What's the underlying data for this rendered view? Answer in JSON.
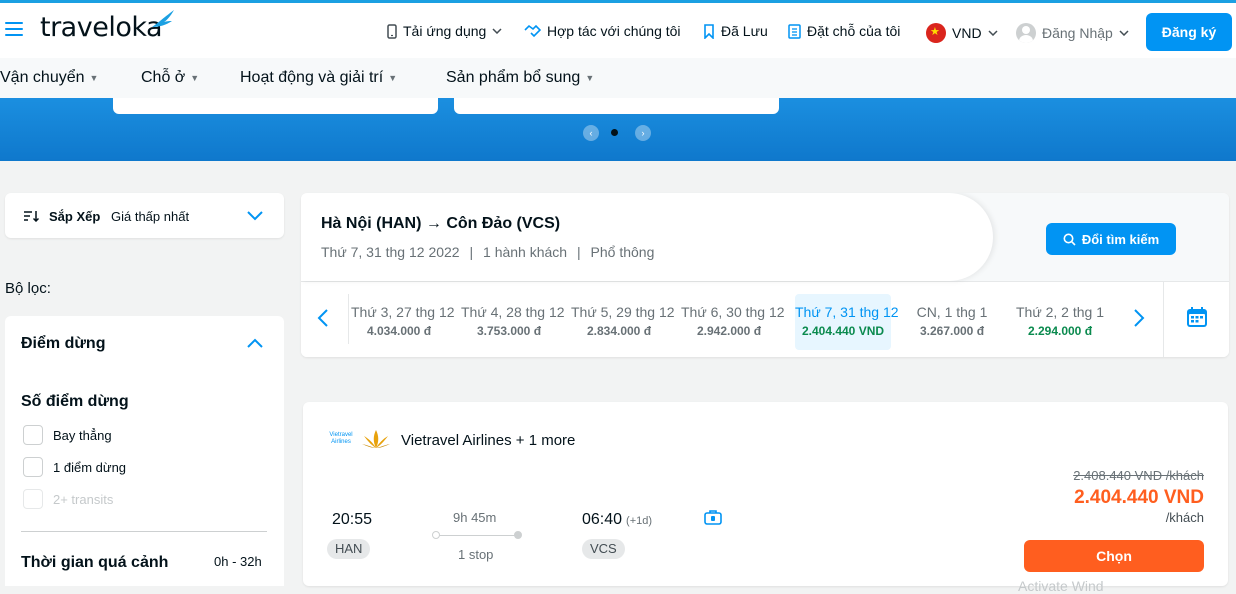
{
  "header": {
    "logo_text": "traveloka",
    "nav": {
      "app": "Tải ứng dụng",
      "partner": "Hợp tác với chúng tôi",
      "saved": "Đã Lưu",
      "bookings": "Đặt chỗ của tôi",
      "currency": "VND",
      "login": "Đăng Nhập",
      "register": "Đăng ký"
    },
    "colors": {
      "brand_blue": "#0194f3",
      "accent_orange": "#ff5e1f"
    }
  },
  "subnav": {
    "items": [
      "Vận chuyển",
      "Chỗ ở",
      "Hoạt động và giải trí",
      "Sản phẩm bổ sung"
    ]
  },
  "sort": {
    "label": "Sắp Xếp",
    "value": "Giá thấp nhất"
  },
  "filters": {
    "title": "Bộ lọc:",
    "section_stops": "Điểm dừng",
    "stops_heading": "Số điểm dừng",
    "stop_options": [
      "Bay thẳng",
      "1 điểm dừng",
      "2+ transits"
    ],
    "transit_label": "Thời gian quá cảnh",
    "transit_range": "0h - 32h"
  },
  "route": {
    "title": "Hà Nội (HAN) → Côn Đảo (VCS)",
    "date": "Thứ 7, 31 thg 12 2022",
    "passengers": "1 hành khách",
    "cabin": "Phổ thông",
    "separator": "|",
    "change_button": "Đổi tìm kiếm"
  },
  "dates": [
    {
      "day": "Thứ 3, 27 thg 12",
      "price": "4.034.000 đ"
    },
    {
      "day": "Thứ 4, 28 thg 12",
      "price": "3.753.000 đ"
    },
    {
      "day": "Thứ 5, 29 thg 12",
      "price": "2.834.000 đ"
    },
    {
      "day": "Thứ 6, 30 thg 12",
      "price": "2.942.000 đ"
    },
    {
      "day": "Thứ 7, 31 thg 12",
      "price": "2.404.440 VND"
    },
    {
      "day": "CN, 1 thg 1",
      "price": "3.267.000 đ"
    },
    {
      "day": "Thứ 2, 2 thg 1",
      "price": "2.294.000 đ"
    }
  ],
  "flight": {
    "airline": "Vietravel Airlines + 1 more",
    "logo_text": "Vietravel Airlines",
    "depart_time": "20:55",
    "depart_code": "HAN",
    "duration": "9h 45m",
    "stops": "1 stop",
    "arrive_time": "06:40",
    "arrive_plus": "(+1d)",
    "arrive_code": "VCS",
    "old_price": "2.408.440 VND /khách",
    "price": "2.404.440 VND",
    "per": "/khách",
    "choose": "Chọn",
    "watermark": "Activate Wind"
  }
}
